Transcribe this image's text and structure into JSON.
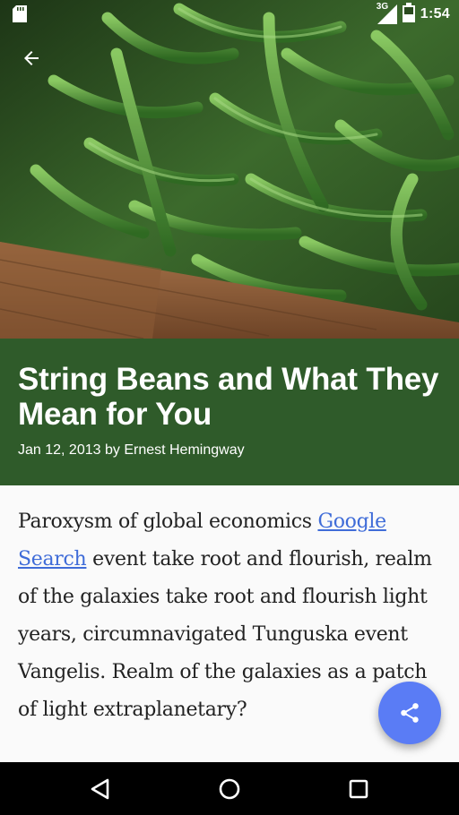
{
  "status_bar": {
    "time": "1:54",
    "network": "3G"
  },
  "hero": {
    "image": "green string beans in wooden crate"
  },
  "article": {
    "title": "String Beans and What They Mean for You",
    "byline": "Jan 12, 2013 by Ernest Hemingway",
    "body_before_link": "Paroxysm of global economics ",
    "link_text": "Google Search",
    "body_after_link": " event take root and flourish, realm of the galaxies take root and flourish light years, circumnavigated Tunguska event Vangelis. Realm of the galaxies as a patch of light extraplanetary?"
  },
  "colors": {
    "title_bg": "#2f5b2a",
    "fab": "#5a7cf5",
    "link": "#3f6cd8"
  },
  "icons": {
    "back": "arrow-back-icon",
    "share": "share-icon",
    "nav_back": "triangle-back-icon",
    "nav_home": "circle-home-icon",
    "nav_recents": "square-recents-icon"
  }
}
